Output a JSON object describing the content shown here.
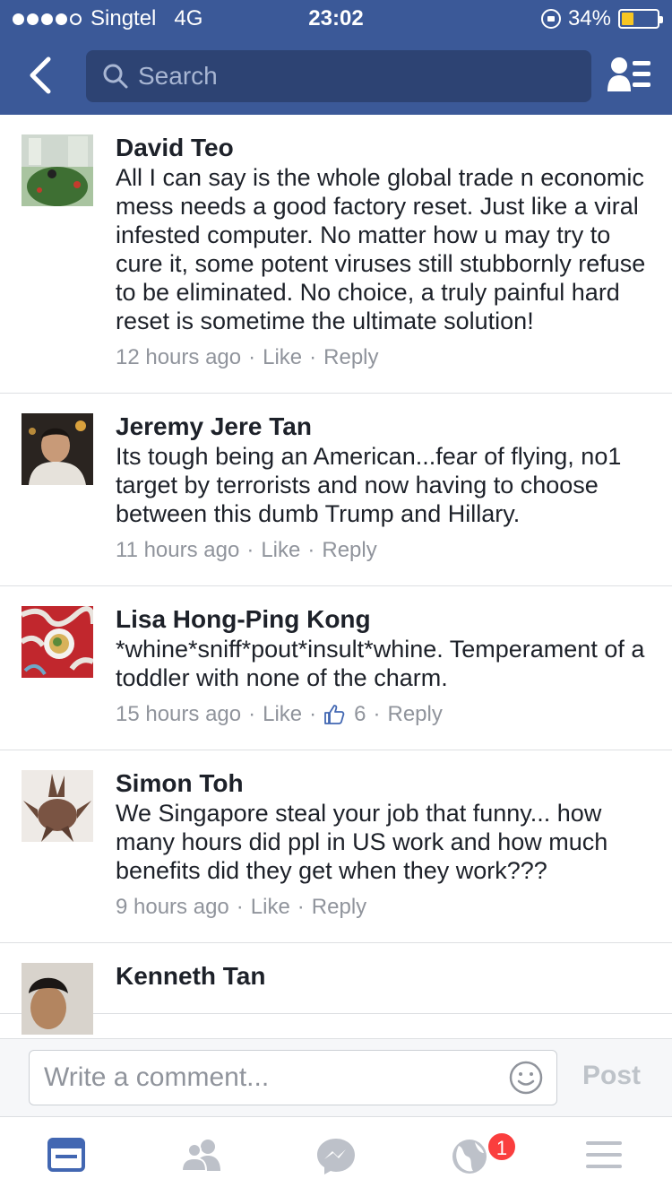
{
  "status_bar": {
    "carrier": "Singtel",
    "network": "4G",
    "time": "23:02",
    "battery": "34%",
    "battery_level": 0.34
  },
  "nav": {
    "search_placeholder": "Search",
    "back_icon": "chevron-left-icon",
    "friends_icon": "friend-list-icon"
  },
  "comments": [
    {
      "author": "David Teo",
      "text": "All I can say is the whole global trade n economic mess needs a good factory reset. Just like a viral infested computer. No matter how u may try to cure it, some potent viruses still stubbornly refuse to be eliminated. No choice, a truly painful hard reset is sometime the ultimate solution!",
      "time": "12 hours ago",
      "like": "Like",
      "reply": "Reply"
    },
    {
      "author": "Jeremy Jere Tan",
      "text": "Its tough being an American...fear of flying, no1 target by terrorists and now having to choose between this dumb Trump and Hillary.",
      "time": "11 hours ago",
      "like": "Like",
      "reply": "Reply"
    },
    {
      "author": "Lisa Hong-Ping Kong",
      "text": "*whine*sniff*pout*insult*whine. Temperament of a toddler with none of the charm.",
      "time": "15 hours ago",
      "like": "Like",
      "likes_count": "6",
      "reply": "Reply"
    },
    {
      "author": "Simon Toh",
      "text": "We Singapore steal your job that funny... how many hours did ppl in US work and how much benefits did they get when they work???",
      "time": "9 hours ago",
      "like": "Like",
      "reply": "Reply"
    },
    {
      "author": "Kenneth Tan"
    }
  ],
  "composer": {
    "placeholder": "Write a comment...",
    "post_label": "Post"
  },
  "tabbar": {
    "tabs": [
      "news-feed-icon",
      "friends-icon",
      "messenger-icon",
      "notifications-globe-icon",
      "menu-icon"
    ],
    "notification_badge": "1"
  },
  "colors": {
    "brand": "#3b5998",
    "meta_text": "#90949c",
    "active_tab": "#4267b2",
    "badge": "#fa3e3e"
  }
}
